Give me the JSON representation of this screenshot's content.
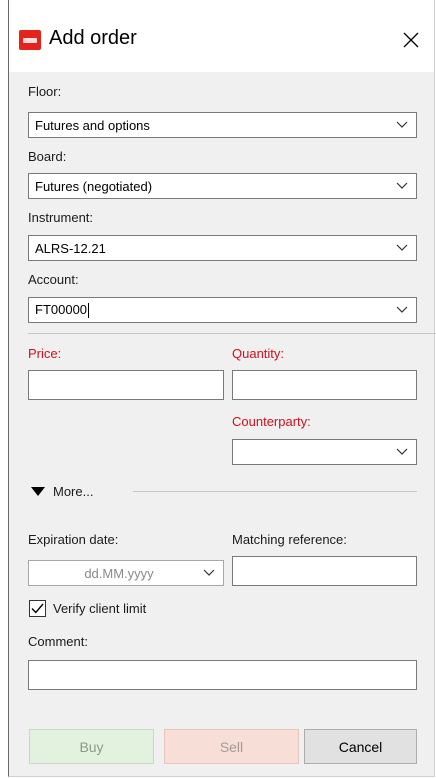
{
  "window": {
    "title": "Add order",
    "icon": "app-logo-icon",
    "close_icon": "close-icon"
  },
  "form": {
    "floor": {
      "label": "Floor:",
      "value": "Futures and options"
    },
    "board": {
      "label": "Board:",
      "value": "Futures (negotiated)"
    },
    "instrument": {
      "label": "Instrument:",
      "value": "ALRS-12.21"
    },
    "account": {
      "label": "Account:",
      "value": "FT00000"
    },
    "price": {
      "label": "Price:",
      "value": ""
    },
    "quantity": {
      "label": "Quantity:",
      "value": ""
    },
    "counterparty": {
      "label": "Counterparty:",
      "value": ""
    },
    "more": {
      "label": "More..."
    },
    "expiration_date": {
      "label": "Expiration date:",
      "placeholder": "dd.MM.yyyy"
    },
    "matching_reference": {
      "label": "Matching reference:",
      "value": ""
    },
    "verify_client_limit": {
      "label": "Verify client limit",
      "checked": true
    },
    "comment": {
      "label": "Comment:",
      "value": ""
    }
  },
  "buttons": {
    "buy": "Buy",
    "sell": "Sell",
    "cancel": "Cancel"
  },
  "colors": {
    "required_label": "#d0101c",
    "buy_bg": "#e2f2df",
    "sell_bg": "#f7ded6",
    "cancel_bg": "#e1e1e1",
    "brand": "#e4241c"
  }
}
